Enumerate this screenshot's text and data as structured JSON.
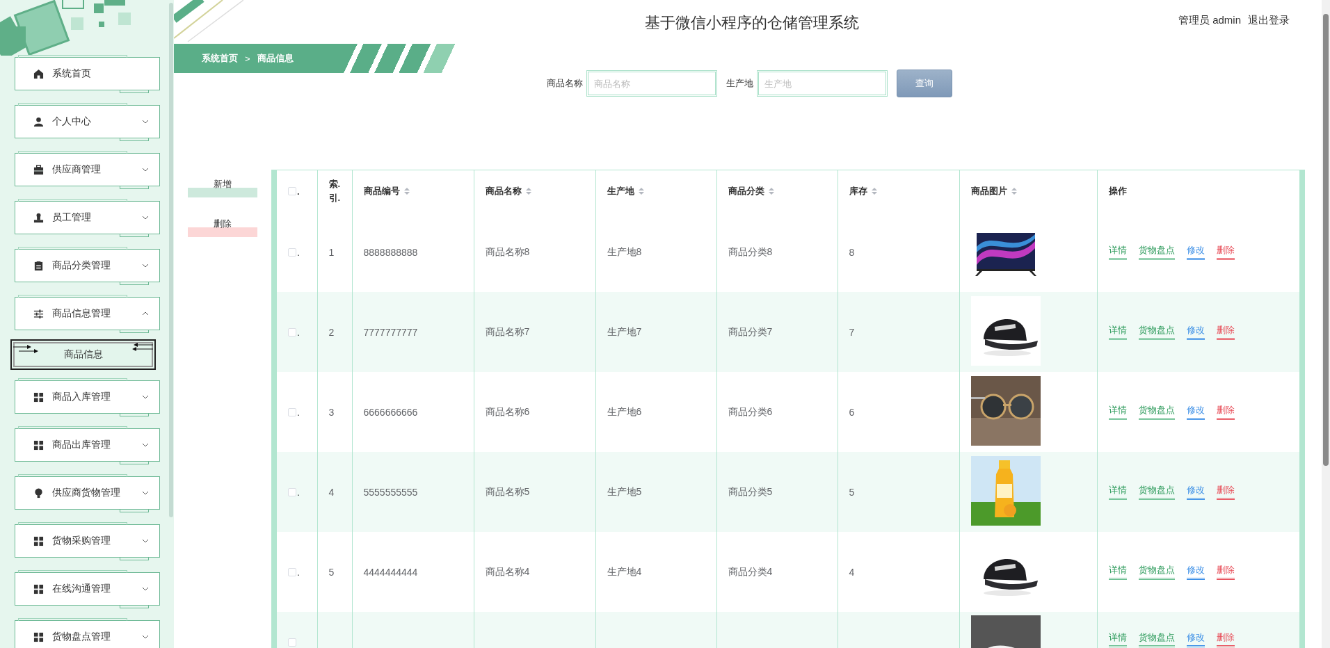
{
  "header": {
    "title": "基于微信小程序的仓储管理系统",
    "user": "管理员 admin",
    "logout": "退出登录"
  },
  "sidebar": {
    "items": [
      {
        "label": "系统首页",
        "kind": "link"
      },
      {
        "label": "个人中心",
        "kind": "submenu",
        "expanded": false
      },
      {
        "label": "供应商管理",
        "kind": "submenu",
        "expanded": false
      },
      {
        "label": "员工管理",
        "kind": "submenu",
        "expanded": false
      },
      {
        "label": "商品分类管理",
        "kind": "submenu",
        "expanded": false
      },
      {
        "label": "商品信息管理",
        "kind": "submenu",
        "expanded": true,
        "children": [
          {
            "label": "商品信息",
            "selected": true
          }
        ]
      },
      {
        "label": "商品入库管理",
        "kind": "submenu",
        "expanded": false
      },
      {
        "label": "商品出库管理",
        "kind": "submenu",
        "expanded": false
      },
      {
        "label": "供应商货物管理",
        "kind": "submenu",
        "expanded": false
      },
      {
        "label": "货物采购管理",
        "kind": "submenu",
        "expanded": false
      },
      {
        "label": "在线沟通管理",
        "kind": "submenu",
        "expanded": false
      },
      {
        "label": "货物盘点管理",
        "kind": "submenu",
        "expanded": false
      }
    ]
  },
  "breadcrumb": {
    "items": [
      "系统首页",
      "商品信息"
    ],
    "separator": ">"
  },
  "search": {
    "fields": [
      {
        "label": "商品名称",
        "placeholder": "商品名称"
      },
      {
        "label": "生产地",
        "placeholder": "生产地"
      }
    ],
    "button": "查询"
  },
  "actions": [
    {
      "label": "新增",
      "kind": "add"
    },
    {
      "label": "删除",
      "kind": "delete"
    }
  ],
  "table": {
    "columns": [
      {
        "kind": "select",
        "checked": false,
        "mark": "."
      },
      {
        "kind": "index",
        "label": "索. 引."
      },
      {
        "kind": "data",
        "label": "商品编号",
        "sortable": true
      },
      {
        "kind": "data",
        "label": "商品名称",
        "sortable": true
      },
      {
        "kind": "data",
        "label": "生产地",
        "sortable": true
      },
      {
        "kind": "data",
        "label": "商品分类",
        "sortable": true
      },
      {
        "kind": "data",
        "label": "库存",
        "sortable": true
      },
      {
        "kind": "data",
        "label": "商品图片",
        "sortable": true
      },
      {
        "kind": "actions",
        "label": "操作",
        "sortable": false
      }
    ],
    "rows": [
      {
        "checked": false,
        "mark": ".",
        "cells": [
          "1",
          "8888888888",
          "商品名称8",
          "生产地8",
          "商品分类8",
          "8"
        ],
        "actions": [
          {
            "label": "详情",
            "kind": "detail"
          },
          {
            "label": "货物盘点",
            "kind": "stock"
          },
          {
            "label": "修改",
            "kind": "edit"
          },
          {
            "label": "删除",
            "kind": "delete"
          }
        ]
      },
      {
        "checked": false,
        "mark": ".",
        "cells": [
          "2",
          "7777777777",
          "商品名称7",
          "生产地7",
          "商品分类7",
          "7"
        ],
        "actions": [
          {
            "label": "详情",
            "kind": "detail"
          },
          {
            "label": "货物盘点",
            "kind": "stock"
          },
          {
            "label": "修改",
            "kind": "edit"
          },
          {
            "label": "删除",
            "kind": "delete"
          }
        ]
      },
      {
        "checked": false,
        "mark": ".",
        "cells": [
          "3",
          "6666666666",
          "商品名称6",
          "生产地6",
          "商品分类6",
          "6"
        ],
        "actions": [
          {
            "label": "详情",
            "kind": "detail"
          },
          {
            "label": "货物盘点",
            "kind": "stock"
          },
          {
            "label": "修改",
            "kind": "edit"
          },
          {
            "label": "删除",
            "kind": "delete"
          }
        ]
      },
      {
        "checked": false,
        "mark": ".",
        "cells": [
          "4",
          "5555555555",
          "商品名称5",
          "生产地5",
          "商品分类5",
          "5"
        ],
        "actions": [
          {
            "label": "详情",
            "kind": "detail"
          },
          {
            "label": "货物盘点",
            "kind": "stock"
          },
          {
            "label": "修改",
            "kind": "edit"
          },
          {
            "label": "删除",
            "kind": "delete"
          }
        ]
      },
      {
        "checked": false,
        "mark": ".",
        "cells": [
          "5",
          "4444444444",
          "商品名称4",
          "生产地4",
          "商品分类4",
          "4"
        ],
        "actions": [
          {
            "label": "详情",
            "kind": "detail"
          },
          {
            "label": "货物盘点",
            "kind": "stock"
          },
          {
            "label": "修改",
            "kind": "edit"
          },
          {
            "label": "删除",
            "kind": "delete"
          }
        ]
      },
      {
        "checked": false,
        "partial": true,
        "actions": [
          {
            "label": "详情",
            "kind": "detail"
          },
          {
            "label": "货物盘点",
            "kind": "stock"
          },
          {
            "label": "修改",
            "kind": "edit"
          },
          {
            "label": "删除",
            "kind": "delete"
          }
        ]
      }
    ]
  }
}
